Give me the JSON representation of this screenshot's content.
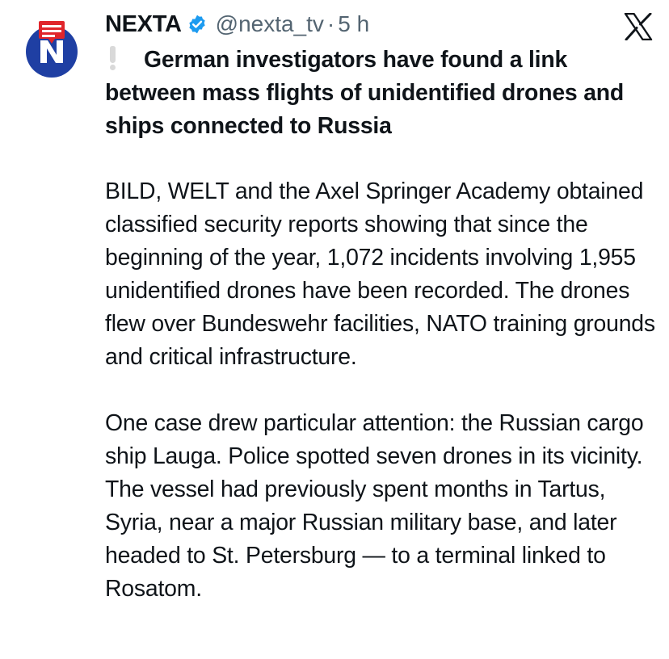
{
  "tweet": {
    "author_name": "NEXTA",
    "handle": "@nexta_tv",
    "separator": "·",
    "time": "5 h",
    "headline": "German investigators have found a link between mass flights of unidentified drones and ships connected to Russia",
    "paragraphs": [
      "BILD, WELT and the Axel Springer Academy obtained classified security reports showing that since the beginning of the year, 1,072 incidents involving 1,955 unidentified drones have been recorded. The drones flew over Bundeswehr facilities, NATO training grounds and critical infrastructure.",
      "One case drew particular attention: the Russian cargo ship Lauga. Police spotted seven drones in its vicinity. The vessel had previously spent months in Tartus, Syria, near a major Russian military base, and later headed to St. Petersburg — to a terminal linked to Rosatom."
    ]
  },
  "icons": {
    "avatar": "nexta-logo",
    "verified": "verified-badge-icon",
    "platform": "x-logo-icon",
    "headline_marker": "exclamation-icon"
  },
  "colors": {
    "text": "#0f1419",
    "secondary_text": "#536471",
    "verified_blue": "#1d9bf0",
    "logo_blue": "#1f3fa3",
    "logo_red": "#e0252b"
  }
}
